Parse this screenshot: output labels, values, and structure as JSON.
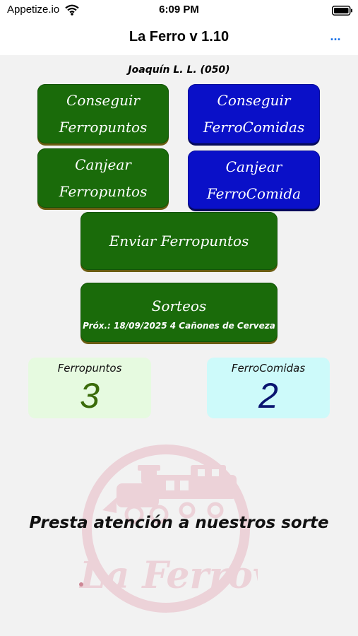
{
  "status_bar": {
    "carrier": "Appetize.io",
    "time": "6:09 PM",
    "wifi_icon": "wifi-icon",
    "battery_icon": "battery-icon"
  },
  "nav": {
    "title": "La Ferro v 1.10",
    "more_label": "..."
  },
  "user": {
    "name": "Joaquín L. L. (050)"
  },
  "buttons": {
    "conseguir_ferropuntos": [
      "Conseguir",
      "Ferropuntos"
    ],
    "conseguir_ferrocomidas": [
      "Conseguir",
      "FerroComidas"
    ],
    "canjear_ferropuntos": [
      "Canjear",
      "Ferropuntos"
    ],
    "canjear_ferrocomida": [
      "Canjear",
      "FerroComida"
    ],
    "enviar_ferropuntos": "Enviar Ferropuntos",
    "sorteos": "Sorteos",
    "sorteos_subtitle": "Próx.: 18/09/2025 4 Cañones de Cerveza"
  },
  "counters": {
    "ferropuntos": {
      "label": "Ferropuntos",
      "value": "3"
    },
    "ferrocomidas": {
      "label": "FerroComidas",
      "value": "2"
    }
  },
  "watermark": {
    "icon": "train-logo-icon",
    "text": "La Ferrovia"
  },
  "promo_text": "Presta atención a nuestros sorte",
  "colors": {
    "green_button": "#1a6b0a",
    "blue_button": "#0a10c8",
    "ferropuntos_bg": "#e6fae0",
    "ferropuntos_value": "#3a6b0a",
    "ferrocomidas_bg": "#cdfafa",
    "ferrocomidas_value": "#0a1470",
    "link_blue": "#1a73e8"
  }
}
